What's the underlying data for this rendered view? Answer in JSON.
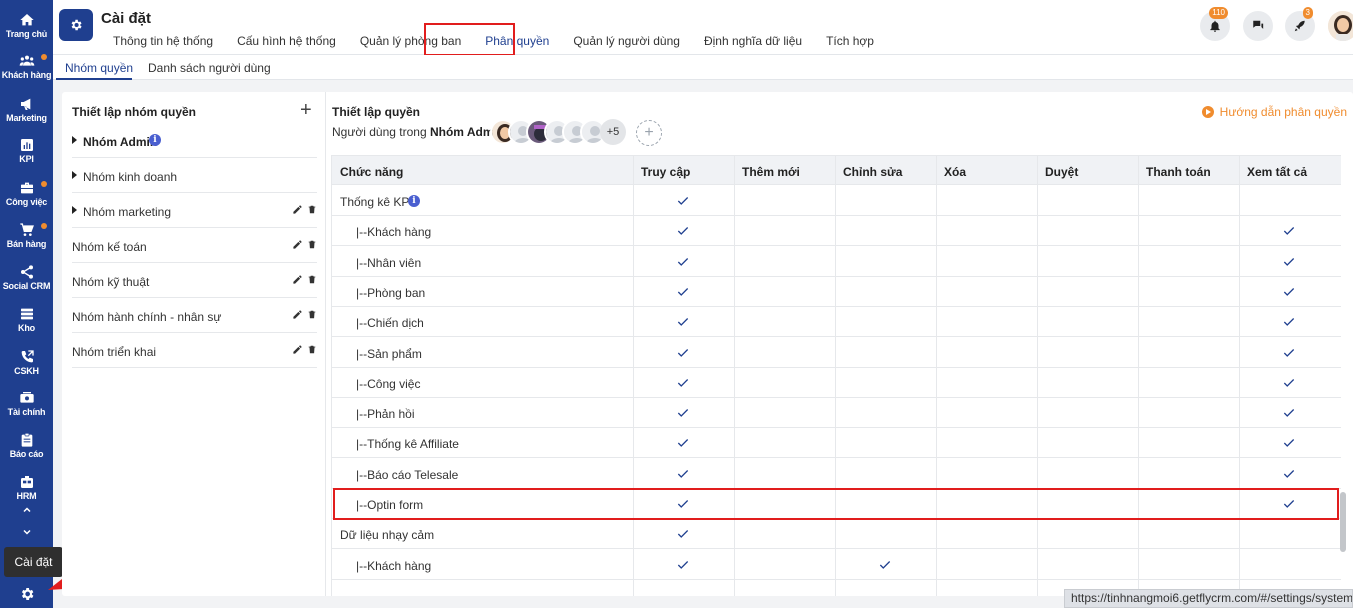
{
  "sidebar": {
    "items": [
      {
        "label": "Trang chủ",
        "icon": "home-icon",
        "dot": false
      },
      {
        "label": "Khách hàng",
        "icon": "users-icon",
        "dot": true
      },
      {
        "label": "Marketing",
        "icon": "megaphone-icon",
        "dot": false
      },
      {
        "label": "KPI",
        "icon": "chart-icon",
        "dot": false
      },
      {
        "label": "Công việc",
        "icon": "briefcase-icon",
        "dot": true
      },
      {
        "label": "Bán hàng",
        "icon": "cart-icon",
        "dot": true
      },
      {
        "label": "Social CRM",
        "icon": "share-icon",
        "dot": false
      },
      {
        "label": "Kho",
        "icon": "warehouse-icon",
        "dot": false
      },
      {
        "label": "CSKH",
        "icon": "phone-icon",
        "dot": false
      },
      {
        "label": "Tài chính",
        "icon": "money-icon",
        "dot": false
      },
      {
        "label": "Báo cáo",
        "icon": "clipboard-icon",
        "dot": false
      },
      {
        "label": "HRM",
        "icon": "hrm-icon",
        "dot": false
      }
    ],
    "tooltip": "Cài đặt"
  },
  "header": {
    "title": "Cài đặt",
    "tabs": [
      {
        "label": "Thông tin hệ thống",
        "active": false
      },
      {
        "label": "Cấu hình hệ thống",
        "active": false
      },
      {
        "label": "Quản lý phòng ban",
        "active": false
      },
      {
        "label": "Phân quyền",
        "active": true
      },
      {
        "label": "Quản lý người dùng",
        "active": false
      },
      {
        "label": "Định nghĩa dữ liệu",
        "active": false
      },
      {
        "label": "Tích hợp",
        "active": false
      }
    ],
    "notifications_count": "110",
    "rocket_count": "3"
  },
  "subtabs": [
    {
      "label": "Nhóm quyền",
      "active": true
    },
    {
      "label": "Danh sách người dùng",
      "active": false
    }
  ],
  "groups": {
    "title": "Thiết lập nhóm quyền",
    "add_symbol": "+",
    "items": [
      {
        "label": "Nhóm Admin",
        "caret": true,
        "bold": true,
        "info": true,
        "actions": false
      },
      {
        "label": "Nhóm kinh doanh",
        "caret": true,
        "bold": false,
        "info": false,
        "actions": false
      },
      {
        "label": "Nhóm marketing",
        "caret": true,
        "bold": false,
        "info": false,
        "actions": true
      },
      {
        "label": "Nhóm kế toán",
        "caret": false,
        "bold": false,
        "info": false,
        "actions": true
      },
      {
        "label": "Nhóm kỹ thuật",
        "caret": false,
        "bold": false,
        "info": false,
        "actions": true
      },
      {
        "label": "Nhóm hành chính - nhân sự",
        "caret": false,
        "bold": false,
        "info": false,
        "actions": true
      },
      {
        "label": "Nhóm triển khai",
        "caret": false,
        "bold": false,
        "info": false,
        "actions": true
      }
    ]
  },
  "permissions": {
    "title": "Thiết lập quyền",
    "users_label": "Người dùng trong",
    "group_name": "Nhóm Admin:",
    "more_users": "+5",
    "add_user_symbol": "+",
    "guide": "Hướng dẫn phân quyền",
    "columns": [
      "Chức năng",
      "Truy cập",
      "Thêm mới",
      "Chỉnh sửa",
      "Xóa",
      "Duyệt",
      "Thanh toán",
      "Xem tất cả"
    ],
    "rows": [
      {
        "label": "Thống kê KPI",
        "info": true,
        "checks": [
          true,
          false,
          false,
          false,
          false,
          false,
          false
        ]
      },
      {
        "label": "|--Khách hàng",
        "info": false,
        "checks": [
          true,
          false,
          false,
          false,
          false,
          false,
          true
        ]
      },
      {
        "label": "|--Nhân viên",
        "info": false,
        "checks": [
          true,
          false,
          false,
          false,
          false,
          false,
          true
        ]
      },
      {
        "label": "|--Phòng ban",
        "info": false,
        "checks": [
          true,
          false,
          false,
          false,
          false,
          false,
          true
        ]
      },
      {
        "label": "|--Chiến dịch",
        "info": false,
        "checks": [
          true,
          false,
          false,
          false,
          false,
          false,
          true
        ]
      },
      {
        "label": "|--Sản phẩm",
        "info": false,
        "checks": [
          true,
          false,
          false,
          false,
          false,
          false,
          true
        ]
      },
      {
        "label": "|--Công việc",
        "info": false,
        "checks": [
          true,
          false,
          false,
          false,
          false,
          false,
          true
        ]
      },
      {
        "label": "|--Phản hồi",
        "info": false,
        "checks": [
          true,
          false,
          false,
          false,
          false,
          false,
          true
        ]
      },
      {
        "label": "|--Thống kê Affiliate",
        "info": false,
        "checks": [
          true,
          false,
          false,
          false,
          false,
          false,
          true
        ]
      },
      {
        "label": "|--Báo cáo Telesale",
        "info": false,
        "checks": [
          true,
          false,
          false,
          false,
          false,
          false,
          true
        ]
      },
      {
        "label": "|--Optin form",
        "info": false,
        "checks": [
          true,
          false,
          false,
          false,
          false,
          false,
          true
        ]
      },
      {
        "label": "Dữ liệu nhạy cảm",
        "info": false,
        "checks": [
          true,
          false,
          false,
          false,
          false,
          false,
          false
        ]
      },
      {
        "label": "|--Khách hàng",
        "info": false,
        "checks": [
          true,
          false,
          true,
          false,
          false,
          false,
          false
        ]
      }
    ]
  },
  "status_url": "https://tinhnangmoi6.getflycrm.com/#/settings/system",
  "colors": {
    "primary": "#1f3f8f",
    "accent": "#f08c2e",
    "highlight": "#e11d1d",
    "check": "#1f3f8f"
  }
}
